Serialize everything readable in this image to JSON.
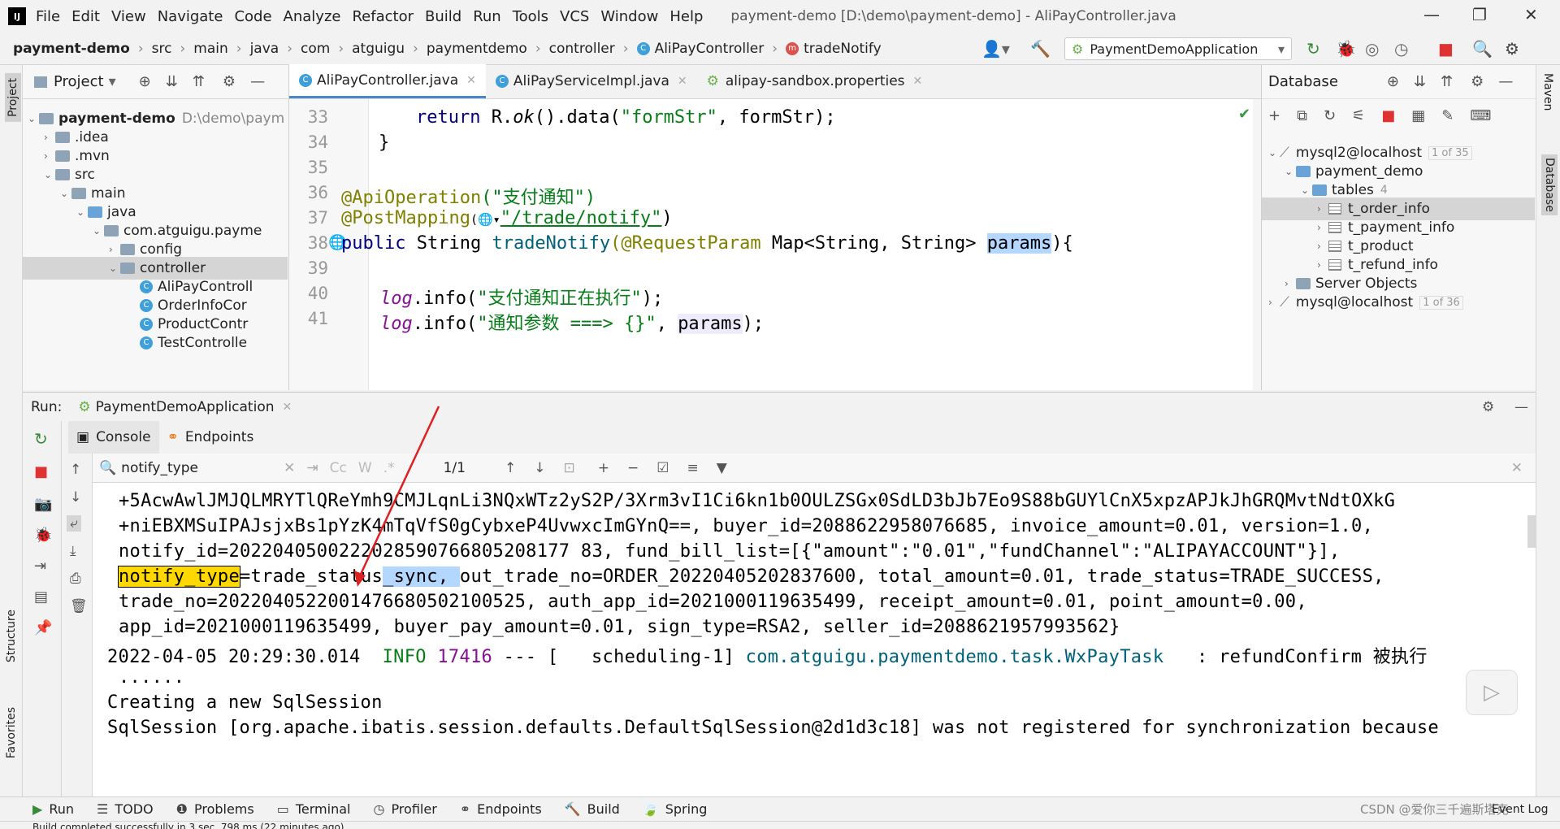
{
  "menubar": {
    "items": [
      "File",
      "Edit",
      "View",
      "Navigate",
      "Code",
      "Analyze",
      "Refactor",
      "Build",
      "Run",
      "Tools",
      "VCS",
      "Window",
      "Help"
    ],
    "title": "payment-demo [D:\\demo\\payment-demo] - AliPayController.java"
  },
  "navbar": {
    "crumbs": [
      "payment-demo",
      "src",
      "main",
      "java",
      "com",
      "atguigu",
      "paymentdemo",
      "controller",
      "AliPayController",
      "tradeNotify"
    ],
    "run_config": "PaymentDemoApplication"
  },
  "project": {
    "title": "Project",
    "tree": [
      {
        "label": "payment-demo",
        "extra": "D:\\demo\\paym"
      },
      {
        "label": ".idea"
      },
      {
        "label": ".mvn"
      },
      {
        "label": "src"
      },
      {
        "label": "main"
      },
      {
        "label": "java"
      },
      {
        "label": "com.atguigu.payme"
      },
      {
        "label": "config"
      },
      {
        "label": "controller"
      },
      {
        "label": "AliPayControll"
      },
      {
        "label": "OrderInfoCor"
      },
      {
        "label": "ProductContr"
      },
      {
        "label": "TestControlle"
      }
    ]
  },
  "left_stripe": {
    "project": "Project",
    "structure": "Structure",
    "favorites": "Favorites"
  },
  "editor": {
    "tabs": [
      "AliPayController.java",
      "AliPayServiceImpl.java",
      "alipay-sandbox.properties"
    ],
    "line_numbers": [
      "33",
      "34",
      "35",
      "36",
      "37",
      "38",
      "39",
      "40",
      "41"
    ],
    "lines": {
      "l33_kw": "return",
      "l33_rest_a": " R.",
      "l33_ok": "ok",
      "l33_rest_b": "().data(",
      "l33_str": "\"formStr\"",
      "l33_rest_c": ", formStr);",
      "l34": "}",
      "l36_ann": "@ApiOperation",
      "l36_str": "(\"支付通知\")",
      "l37_ann": "@PostMapping",
      "l37_icon": "(🌐▾",
      "l37_str": "\"/trade/notify\"",
      "l37_end": ")",
      "l38_kw": "public",
      "l38_type": " String ",
      "l38_fn": "tradeNotify",
      "l38_ann": "(@RequestParam",
      "l38_rest": " Map<String, String> ",
      "l38_param": "params",
      "l38_end": "){",
      "l40_log": "log",
      "l40_rest": ".info(",
      "l40_str": "\"支付通知正在执行\"",
      "l40_end": ");",
      "l41_log": "log",
      "l41_rest": ".info(",
      "l41_str": "\"通知参数 ===> {}\"",
      "l41_comma": ", ",
      "l41_param": "params",
      "l41_end": ");"
    }
  },
  "database": {
    "title": "Database",
    "items": [
      {
        "label": "mysql2@localhost",
        "badge": "1 of 35"
      },
      {
        "label": "payment_demo"
      },
      {
        "label": "tables",
        "badge": "4"
      },
      {
        "label": "t_order_info"
      },
      {
        "label": "t_payment_info"
      },
      {
        "label": "t_product"
      },
      {
        "label": "t_refund_info"
      },
      {
        "label": "Server Objects"
      },
      {
        "label": "mysql@localhost",
        "badge": "1 of 36"
      }
    ]
  },
  "right_stripe": {
    "maven": "Maven",
    "database": "Database"
  },
  "run": {
    "label": "Run:",
    "app": "PaymentDemoApplication",
    "tabs": [
      "Console",
      "Endpoints"
    ],
    "search_value": "notify_type",
    "match_count": "1/1",
    "cc": "Cc",
    "w": "W"
  },
  "console": {
    "line0": "+5AcwAwlJMJQLMRYTlQReYmh9CMJLqnLi3NQxWTz2yS2P/3Xrm3vI1Ci6kn1b0OULZSGx0SdLD3bJb7Eo9S88bGUYlCnX5xpzAPJkJhGRQMvtNdtOXkG",
    "line1": "+niEBXMSuIPAJsjxBs1pYzK4mTqVfS0gCybxeP4UvwxcImGYnQ==, buyer_id=2088622958076685, invoice_amount=0.01, version=1.0,",
    "line2": "notify_id=2022040500222028590766805208177 83, fund_bill_list=[{\"amount\":\"0.01\",\"fundChannel\":\"ALIPAYACCOUNT\"}],",
    "line3_hl": "notify_type",
    "line3_a": "=trade_status",
    "line3_b": "_sync, ",
    "line3_c": "out_trade_no=ORDER_20220405202837600, total_amount=0.01, trade_status=TRADE_SUCCESS,",
    "line4": "trade_no=2022040522001476680502100525, auth_app_id=2021000119635499, receipt_amount=0.01, point_amount=0.00,",
    "line5": "app_id=2021000119635499, buyer_pay_amount=0.01, sign_type=RSA2, seller_id=2088621957993562}",
    "line6_time": "2022-04-05 20:29:30.014  ",
    "line6_info": "INFO",
    "line6_pid": " 17416",
    "line6_mid": " --- [   scheduling-1] ",
    "line6_cls": "com.atguigu.paymentdemo.task.WxPayTask",
    "line6_msg": "   : refundConfirm 被执行",
    "line7": "......",
    "line8": "Creating a new SqlSession",
    "line9": "SqlSession [org.apache.ibatis.session.defaults.DefaultSqlSession@2d1d3c18] was not registered for synchronization because"
  },
  "bottombar": {
    "items": [
      "Run",
      "TODO",
      "Problems",
      "Terminal",
      "Profiler",
      "Endpoints",
      "Build",
      "Spring"
    ],
    "event_log": "Event Log",
    "watermark": "CSDN @爱你三千遍斯塔克"
  },
  "statusbar": {
    "text": "Build completed successfully in 3 sec, 798 ms (22 minutes ago)"
  },
  "colors": {
    "accent": "#4a88c7",
    "selection": "#b4d7ff",
    "search_hit": "#ffd800",
    "annotation_arrow": "#e02020"
  }
}
